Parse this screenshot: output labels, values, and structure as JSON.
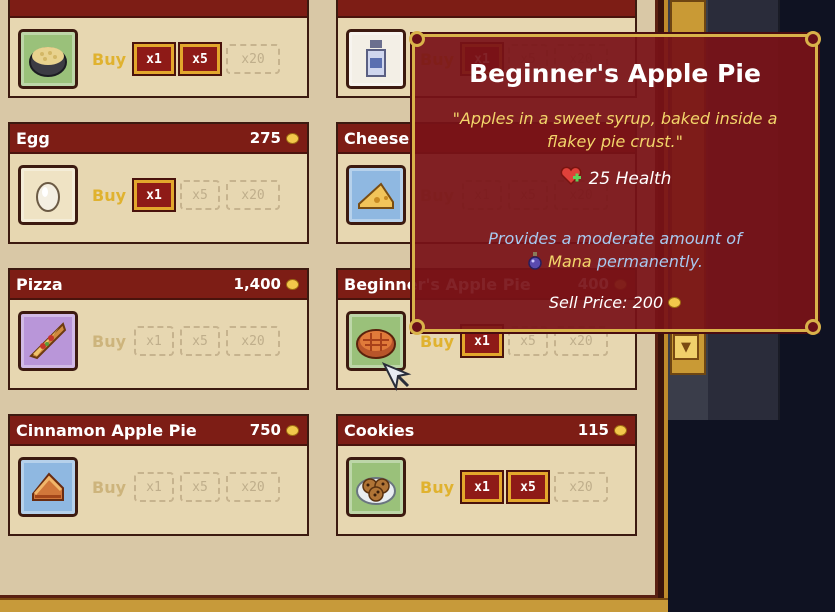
{
  "shop": {
    "buy_label": "Buy",
    "items": [
      {
        "name": "",
        "price": "",
        "icon": "rice-bowl-icon",
        "qty": [
          "x1",
          "x5",
          "x20"
        ],
        "active": [
          true,
          true,
          false
        ]
      },
      {
        "name": "",
        "price": "",
        "icon": "milk-bottle-icon",
        "qty": [
          "x1",
          "x5",
          "x20"
        ],
        "active": [
          true,
          false,
          false
        ]
      },
      {
        "name": "Egg",
        "price": "275",
        "icon": "egg-icon",
        "qty": [
          "x1",
          "x5",
          "x20"
        ],
        "active": [
          true,
          false,
          false
        ]
      },
      {
        "name": "Cheese",
        "price": "",
        "icon": "cheese-icon",
        "qty": [
          "x1",
          "x5",
          "x20"
        ],
        "active": [
          false,
          false,
          false
        ]
      },
      {
        "name": "Pizza",
        "price": "1,400",
        "icon": "pizza-slice-icon",
        "qty": [
          "x1",
          "x5",
          "x20"
        ],
        "active": [
          false,
          false,
          false
        ]
      },
      {
        "name": "Beginner's Apple Pie",
        "price": "400",
        "icon": "apple-pie-icon",
        "qty": [
          "x1",
          "x5",
          "x20"
        ],
        "active": [
          true,
          false,
          false
        ]
      },
      {
        "name": "Cinnamon Apple Pie",
        "price": "750",
        "icon": "cinnamon-pie-slice-icon",
        "qty": [
          "x1",
          "x5",
          "x20"
        ],
        "active": [
          false,
          false,
          false
        ]
      },
      {
        "name": "Cookies",
        "price": "115",
        "icon": "cookies-plate-icon",
        "qty": [
          "x1",
          "x5",
          "x20"
        ],
        "active": [
          true,
          true,
          false
        ]
      }
    ]
  },
  "tooltip": {
    "title": "Beginner's Apple Pie",
    "description": "\"Apples in a sweet syrup, baked inside a flakey pie crust.\"",
    "health": "25 Health",
    "effect_prefix": "Provides a moderate amount of",
    "effect_mana": "Mana",
    "effect_suffix": "permanently.",
    "sell_price": "Sell Price: 200"
  },
  "colors": {
    "header_red": "#7d1d15",
    "card_bg": "#e7d7b1",
    "buy_gold": "#e0b22f",
    "tooltip_bg": "#781218",
    "tooltip_border": "#d9b24a",
    "mana_text": "#a8c9ef"
  }
}
